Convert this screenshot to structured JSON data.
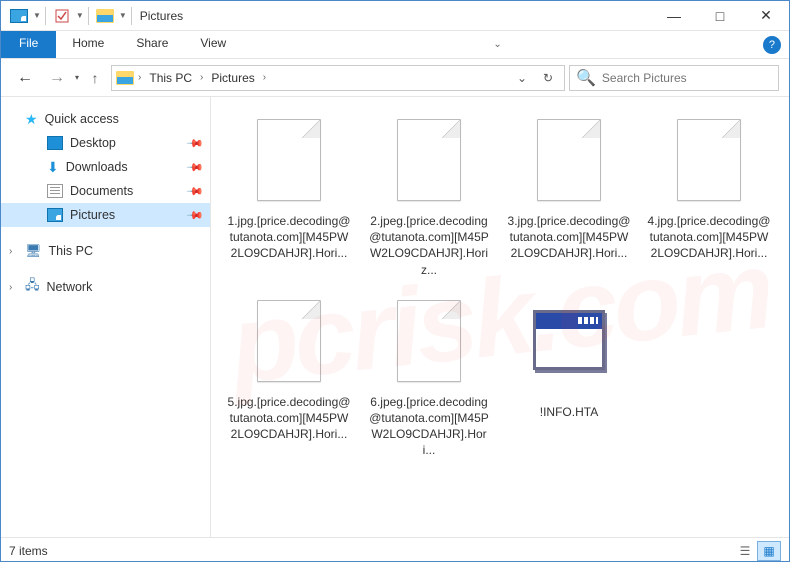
{
  "window": {
    "title": "Pictures",
    "minimize": "—",
    "maximize": "□",
    "close": "✕"
  },
  "ribbon": {
    "file": "File",
    "tabs": [
      "Home",
      "Share",
      "View"
    ],
    "help": "?"
  },
  "address": {
    "segments": [
      "This PC",
      "Pictures"
    ],
    "search_placeholder": "Search Pictures"
  },
  "sidebar": {
    "quick_access": "Quick access",
    "pinned": [
      {
        "icon": "desktop",
        "label": "Desktop"
      },
      {
        "icon": "downloads",
        "label": "Downloads"
      },
      {
        "icon": "documents",
        "label": "Documents"
      },
      {
        "icon": "pictures",
        "label": "Pictures"
      }
    ],
    "this_pc": "This PC",
    "network": "Network"
  },
  "files": [
    {
      "type": "blank",
      "name": "1.jpg.[price.decoding@tutanota.com][M45PW2LO9CDAHJR].Hori..."
    },
    {
      "type": "blank",
      "name": "2.jpeg.[price.decoding@tutanota.com][M45PW2LO9CDAHJR].Horiz..."
    },
    {
      "type": "blank",
      "name": "3.jpg.[price.decoding@tutanota.com][M45PW2LO9CDAHJR].Hori..."
    },
    {
      "type": "blank",
      "name": "4.jpg.[price.decoding@tutanota.com][M45PW2LO9CDAHJR].Hori..."
    },
    {
      "type": "blank",
      "name": "5.jpg.[price.decoding@tutanota.com][M45PW2LO9CDAHJR].Hori..."
    },
    {
      "type": "blank",
      "name": "6.jpeg.[price.decoding@tutanota.com][M45PW2LO9CDAHJR].Hori..."
    },
    {
      "type": "hta",
      "name": "!INFO.HTA"
    }
  ],
  "status": {
    "count": "7 items"
  },
  "watermark": "pcrisk.com"
}
